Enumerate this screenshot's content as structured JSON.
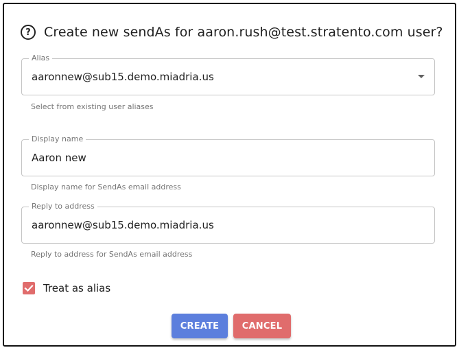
{
  "dialog": {
    "title": "Create new sendAs for aaron.rush@test.stratento.com user?",
    "help_icon": "help-circle-icon"
  },
  "alias": {
    "label": "Alias",
    "value": "aaronnew@sub15.demo.miadria.us",
    "helper": "Select from existing user aliases",
    "icon": "caret-down-icon"
  },
  "display_name": {
    "label": "Display name",
    "value": "Aaron new",
    "helper": "Display name for SendAs email address"
  },
  "reply_to": {
    "label": "Reply to address",
    "value": "aaronnew@sub15.demo.miadria.us",
    "helper": "Reply to address for SendAs email address"
  },
  "treat_as_alias": {
    "label": "Treat as alias",
    "checked": true,
    "icon": "checkmark-icon"
  },
  "buttons": {
    "create": "CREATE",
    "cancel": "CANCEL"
  },
  "colors": {
    "create": "#5c7fdd",
    "cancel": "#e06c6c",
    "checkbox": "#e06c6c"
  }
}
